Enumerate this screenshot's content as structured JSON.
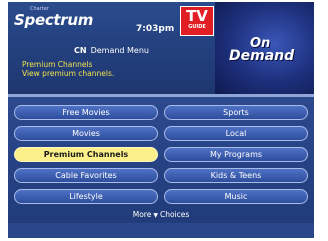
{
  "header": {
    "brand_prefix": "Charter",
    "brand_name": "Spectrum",
    "time": "7:03pm",
    "tv_guide_logo": {
      "top": "TV",
      "bottom": "GUIDE"
    },
    "menu_title_network": "CN",
    "menu_title": "Demand Menu",
    "selection_title": "Premium Channels",
    "selection_description": "View premium channels."
  },
  "promo": {
    "line1": "On",
    "line2": "Demand"
  },
  "menu": {
    "left_column": [
      {
        "label": "Free Movies",
        "selected": false
      },
      {
        "label": "Movies",
        "selected": false
      },
      {
        "label": "Premium Channels",
        "selected": true
      },
      {
        "label": "Cable Favorites",
        "selected": false
      },
      {
        "label": "Lifestyle",
        "selected": false
      }
    ],
    "right_column": [
      {
        "label": "Sports",
        "selected": false
      },
      {
        "label": "Local",
        "selected": false
      },
      {
        "label": "My Programs",
        "selected": false
      },
      {
        "label": "Kids & Teens",
        "selected": false
      },
      {
        "label": "Music",
        "selected": false
      }
    ]
  },
  "more_choices": {
    "left": "More",
    "right": "Choices",
    "icon": "triangle-down-icon"
  },
  "colors": {
    "background": "#26417a",
    "button": "#3e5fb4",
    "button_selected": "#fbf08a",
    "info_text": "#f2e24c",
    "tv_guide_red": "#e01e24"
  }
}
